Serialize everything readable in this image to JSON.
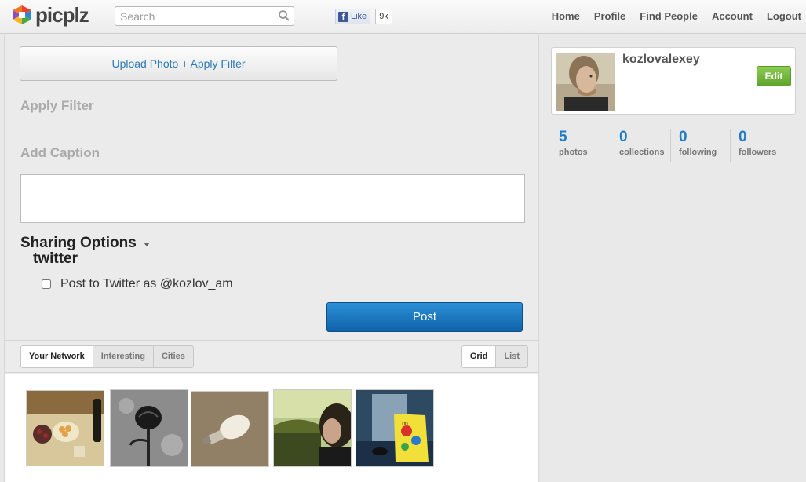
{
  "header": {
    "logo_text": "picplz",
    "search_placeholder": "Search",
    "fb_like_label": "Like",
    "fb_like_count": "9k",
    "nav": [
      "Home",
      "Profile",
      "Find People",
      "Account",
      "Logout"
    ]
  },
  "composer": {
    "upload_label": "Upload Photo + Apply Filter",
    "apply_filter_label": "Apply Filter",
    "add_caption_label": "Add Caption",
    "caption_value": "",
    "sharing_title": "Sharing Options",
    "twitter_title": "twitter",
    "twitter_checkbox_label": "Post to Twitter as @kozlov_am",
    "twitter_checked": false,
    "post_label": "Post"
  },
  "feed": {
    "tabs": [
      "Your Network",
      "Interesting",
      "Cities"
    ],
    "active_tab": "Your Network",
    "views": [
      "Grid",
      "List"
    ],
    "active_view": "Grid"
  },
  "profile": {
    "username": "kozlovalexey",
    "edit_label": "Edit",
    "stats": [
      {
        "value": "5",
        "label": "photos"
      },
      {
        "value": "0",
        "label": "collections"
      },
      {
        "value": "0",
        "label": "following"
      },
      {
        "value": "0",
        "label": "followers"
      }
    ]
  },
  "colors": {
    "link_blue": "#2a7ab8",
    "post_blue": "#1a74bd",
    "stat_blue": "#1f7cc7",
    "edit_green": "#6db33b"
  },
  "icons": [
    "picplz-logo-icon",
    "search-icon",
    "facebook-icon",
    "caret-down-icon"
  ]
}
